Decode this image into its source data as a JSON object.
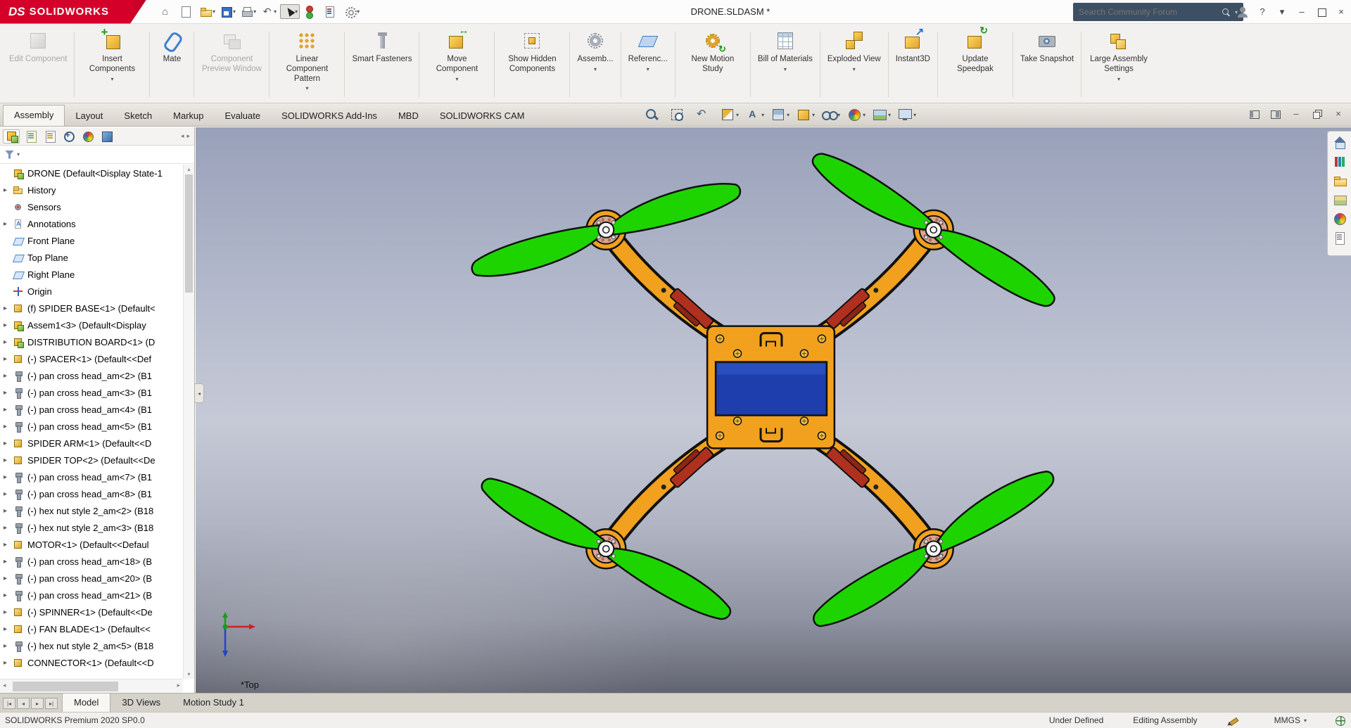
{
  "colors": {
    "frame": "#F2A11E",
    "prop": "#1ED400",
    "battery": "#1D3EAC",
    "red_part": "#B03020",
    "copper": "#DCA693"
  },
  "titlebar": {
    "logo_ds": "DS",
    "logo_text": "SOLIDWORKS",
    "title": "DRONE.SLDASM *",
    "search_placeholder": "Search Community Forum",
    "quick_icons": [
      {
        "icon": "home-icon",
        "glyph": "⌂",
        "caret": false,
        "pressed": false,
        "disabled": false
      },
      {
        "icon": "new-document-icon",
        "glyph": "",
        "caret": false,
        "pressed": false,
        "disabled": false
      },
      {
        "icon": "open-folder-icon",
        "glyph": "",
        "caret": true,
        "pressed": false,
        "disabled": false
      },
      {
        "icon": "save-icon",
        "glyph": "",
        "caret": true,
        "pressed": false,
        "disabled": false
      },
      {
        "icon": "print-icon",
        "glyph": "",
        "caret": true,
        "pressed": false,
        "disabled": false
      },
      {
        "icon": "undo-icon",
        "glyph": "↶",
        "caret": true,
        "pressed": false,
        "disabled": true
      },
      {
        "icon": "select-cursor-icon",
        "glyph": "",
        "caret": true,
        "pressed": true,
        "disabled": false
      },
      {
        "icon": "rebuild-icon",
        "glyph": "",
        "caret": false,
        "pressed": false,
        "disabled": false
      },
      {
        "icon": "file-properties-icon",
        "glyph": "",
        "caret": false,
        "pressed": false,
        "disabled": false
      },
      {
        "icon": "options-gear-icon",
        "glyph": "",
        "caret": true,
        "pressed": false,
        "disabled": false
      }
    ],
    "right_icons": [
      {
        "icon": "user-icon",
        "glyph": ""
      },
      {
        "icon": "help-icon",
        "glyph": "?"
      },
      {
        "icon": "help-caret-icon",
        "glyph": "▾"
      },
      {
        "icon": "minimize-icon",
        "glyph": "–"
      },
      {
        "icon": "maximize-icon",
        "glyph": ""
      },
      {
        "icon": "close-icon",
        "glyph": "×"
      }
    ]
  },
  "ribbon": {
    "buttons": [
      {
        "label": "Edit Component",
        "icon": "edit-component-icon",
        "disabled": true,
        "caret": false,
        "divider": true
      },
      {
        "label": "Insert Components",
        "icon": "insert-components-icon",
        "disabled": false,
        "caret": true,
        "divider": true
      },
      {
        "label": "Mate",
        "icon": "mate-icon",
        "disabled": false,
        "caret": false,
        "divider": true
      },
      {
        "label": "Component Preview Window",
        "icon": "component-preview-icon",
        "disabled": true,
        "caret": false,
        "divider": true
      },
      {
        "label": "Linear Component Pattern",
        "icon": "linear-pattern-icon",
        "disabled": false,
        "caret": true,
        "divider": true
      },
      {
        "label": "Smart Fasteners",
        "icon": "smart-fasteners-icon",
        "disabled": false,
        "caret": false,
        "divider": true
      },
      {
        "label": "Move Component",
        "icon": "move-component-icon",
        "disabled": false,
        "caret": true,
        "divider": true
      },
      {
        "label": "Show Hidden Components",
        "icon": "show-hidden-icon",
        "disabled": false,
        "caret": false,
        "divider": true
      },
      {
        "label": "Assemb...",
        "icon": "assembly-features-icon",
        "disabled": false,
        "caret": true,
        "divider": true
      },
      {
        "label": "Referenc...",
        "icon": "reference-geometry-icon",
        "disabled": false,
        "caret": true,
        "divider": true
      },
      {
        "label": "New Motion Study",
        "icon": "motion-study-icon",
        "disabled": false,
        "caret": false,
        "divider": true
      },
      {
        "label": "Bill of Materials",
        "icon": "bom-icon",
        "disabled": false,
        "caret": true,
        "divider": true
      },
      {
        "label": "Exploded View",
        "icon": "exploded-view-icon",
        "disabled": false,
        "caret": true,
        "divider": true
      },
      {
        "label": "Instant3D",
        "icon": "instant3d-icon",
        "disabled": false,
        "caret": false,
        "divider": true
      },
      {
        "label": "Update Speedpak",
        "icon": "update-speedpak-icon",
        "disabled": false,
        "caret": false,
        "divider": true
      },
      {
        "label": "Take Snapshot",
        "icon": "take-snapshot-icon",
        "disabled": false,
        "caret": false,
        "divider": true
      },
      {
        "label": "Large Assembly Settings",
        "icon": "large-assembly-icon",
        "disabled": false,
        "caret": true,
        "divider": false
      }
    ]
  },
  "command_tabs": {
    "items": [
      {
        "label": "Assembly",
        "active": true
      },
      {
        "label": "Layout",
        "active": false
      },
      {
        "label": "Sketch",
        "active": false
      },
      {
        "label": "Markup",
        "active": false
      },
      {
        "label": "Evaluate",
        "active": false
      },
      {
        "label": "SOLIDWORKS Add-Ins",
        "active": false
      },
      {
        "label": "MBD",
        "active": false
      },
      {
        "label": "SOLIDWORKS CAM",
        "active": false
      }
    ]
  },
  "headsup": {
    "icons": [
      {
        "icon": "zoom-fit-icon",
        "caret": false
      },
      {
        "icon": "zoom-area-icon",
        "caret": false
      },
      {
        "icon": "previous-view-icon",
        "caret": false
      },
      {
        "icon": "section-view-icon",
        "caret": true
      },
      {
        "icon": "annotation-views-icon",
        "caret": true
      },
      {
        "icon": "view-orientation-icon",
        "caret": true
      },
      {
        "icon": "display-style-icon",
        "caret": true
      },
      {
        "icon": "hide-show-icon",
        "caret": true
      },
      {
        "icon": "appearance-ball-icon",
        "caret": true
      },
      {
        "icon": "scene-icon",
        "caret": true
      },
      {
        "icon": "view-settings-icon",
        "caret": true
      }
    ]
  },
  "docwin": {
    "icons": [
      {
        "icon": "pane-left-icon",
        "glyph": ""
      },
      {
        "icon": "pane-right-icon",
        "glyph": ""
      },
      {
        "icon": "doc-minimize-icon",
        "glyph": "–"
      },
      {
        "icon": "doc-restore-icon",
        "glyph": ""
      },
      {
        "icon": "doc-close-icon",
        "glyph": "×"
      }
    ]
  },
  "panel": {
    "tabs": [
      {
        "icon": "feature-manager-tab-icon",
        "active": true
      },
      {
        "icon": "property-manager-tab-icon",
        "active": false
      },
      {
        "icon": "configuration-manager-tab-icon",
        "active": false
      },
      {
        "icon": "dimxpert-manager-tab-icon",
        "active": false
      },
      {
        "icon": "display-manager-tab-icon",
        "active": false
      },
      {
        "icon": "cam-manager-tab-icon",
        "active": false
      }
    ],
    "scroll_left": "◂",
    "scroll_right": "▸"
  },
  "tree": {
    "rows": [
      {
        "label": "DRONE (Default<Display State-1",
        "icon": "assembly-icon",
        "arrow": false
      },
      {
        "label": "History",
        "icon": "history-folder-icon",
        "arrow": true
      },
      {
        "label": "Sensors",
        "icon": "sensors-icon",
        "arrow": false
      },
      {
        "label": "Annotations",
        "icon": "annotations-icon",
        "arrow": true
      },
      {
        "label": "Front Plane",
        "icon": "plane-icon",
        "arrow": false
      },
      {
        "label": "Top Plane",
        "icon": "plane-icon",
        "arrow": false
      },
      {
        "label": "Right Plane",
        "icon": "plane-icon",
        "arrow": false
      },
      {
        "label": "Origin",
        "icon": "origin-icon",
        "arrow": false
      },
      {
        "label": "(f) SPIDER BASE<1> (Default<",
        "icon": "part-icon",
        "arrow": true
      },
      {
        "label": "Assem1<3> (Default<Display",
        "icon": "subassembly-icon",
        "arrow": true
      },
      {
        "label": "DISTRIBUTION BOARD<1> (D",
        "icon": "subassembly-icon",
        "arrow": true
      },
      {
        "label": "(-) SPACER<1> (Default<<Def",
        "icon": "part-icon",
        "arrow": true
      },
      {
        "label": "(-) pan cross head_am<2> (B1",
        "icon": "screw-icon",
        "arrow": true
      },
      {
        "label": "(-) pan cross head_am<3> (B1",
        "icon": "screw-icon",
        "arrow": true
      },
      {
        "label": "(-) pan cross head_am<4> (B1",
        "icon": "screw-icon",
        "arrow": true
      },
      {
        "label": "(-) pan cross head_am<5> (B1",
        "icon": "screw-icon",
        "arrow": true
      },
      {
        "label": "SPIDER ARM<1> (Default<<D",
        "icon": "part-icon",
        "arrow": true
      },
      {
        "label": "SPIDER TOP<2> (Default<<De",
        "icon": "part-icon",
        "arrow": true
      },
      {
        "label": "(-) pan cross head_am<7> (B1",
        "icon": "screw-icon",
        "arrow": true
      },
      {
        "label": "(-) pan cross head_am<8> (B1",
        "icon": "screw-icon",
        "arrow": true
      },
      {
        "label": "(-) hex nut style 2_am<2> (B18",
        "icon": "screw-icon",
        "arrow": true
      },
      {
        "label": "(-) hex nut style 2_am<3> (B18",
        "icon": "screw-icon",
        "arrow": true
      },
      {
        "label": "MOTOR<1> (Default<<Defaul",
        "icon": "part-icon",
        "arrow": true
      },
      {
        "label": "(-) pan cross head_am<18> (B",
        "icon": "screw-icon",
        "arrow": true
      },
      {
        "label": "(-) pan cross head_am<20> (B",
        "icon": "screw-icon",
        "arrow": true
      },
      {
        "label": "(-) pan cross head_am<21> (B",
        "icon": "screw-icon",
        "arrow": true
      },
      {
        "label": "(-) SPINNER<1> (Default<<De",
        "icon": "part-icon",
        "arrow": true
      },
      {
        "label": "(-) FAN BLADE<1> (Default<<",
        "icon": "part-icon",
        "arrow": true
      },
      {
        "label": "(-) hex nut style 2_am<5> (B18",
        "icon": "screw-icon",
        "arrow": true
      },
      {
        "label": "CONNECTOR<1> (Default<<D",
        "icon": "part-icon",
        "arrow": true
      }
    ]
  },
  "viewport": {
    "view_label": "*Top"
  },
  "taskpane": {
    "icons": [
      {
        "icon": "home-tab-icon"
      },
      {
        "icon": "design-library-icon"
      },
      {
        "icon": "file-explorer-icon"
      },
      {
        "icon": "view-palette-icon"
      },
      {
        "icon": "appearances-tab-icon"
      },
      {
        "icon": "custom-properties-icon"
      }
    ]
  },
  "bottom": {
    "nav_icons": [
      {
        "icon": "tab-scroll-first-icon",
        "glyph": "|◂"
      },
      {
        "icon": "tab-scroll-prev-icon",
        "glyph": "◂"
      },
      {
        "icon": "tab-scroll-next-icon",
        "glyph": "▸"
      },
      {
        "icon": "tab-scroll-last-icon",
        "glyph": "▸|"
      }
    ],
    "tabs": [
      {
        "label": "Model",
        "active": true
      },
      {
        "label": "3D Views",
        "active": false
      },
      {
        "label": "Motion Study 1",
        "active": false
      }
    ]
  },
  "statusbar": {
    "left": "SOLIDWORKS Premium 2020 SP0.0",
    "constraint_status": "Under Defined",
    "mode": "Editing Assembly",
    "units": "MMGS"
  }
}
